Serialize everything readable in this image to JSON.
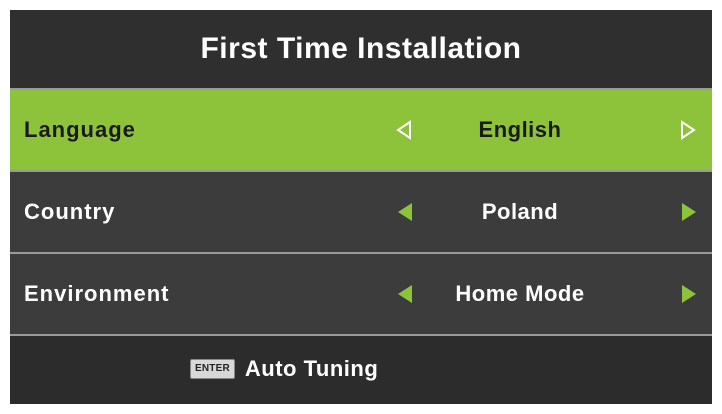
{
  "window": {
    "title": "First Time Installation"
  },
  "colors": {
    "accent": "#8dc33b",
    "background": "#2c2c2c",
    "row_background": "#3c3c3c"
  },
  "settings": [
    {
      "label": "Language",
      "value": "English",
      "selected": true
    },
    {
      "label": "Country",
      "value": "Poland",
      "selected": false
    },
    {
      "label": "Environment",
      "value": "Home Mode",
      "selected": false
    }
  ],
  "footer": {
    "key_label": "ENTER",
    "action_label": "Auto Tuning"
  },
  "icons": {
    "left": "triangle-left-icon",
    "right": "triangle-right-icon"
  }
}
